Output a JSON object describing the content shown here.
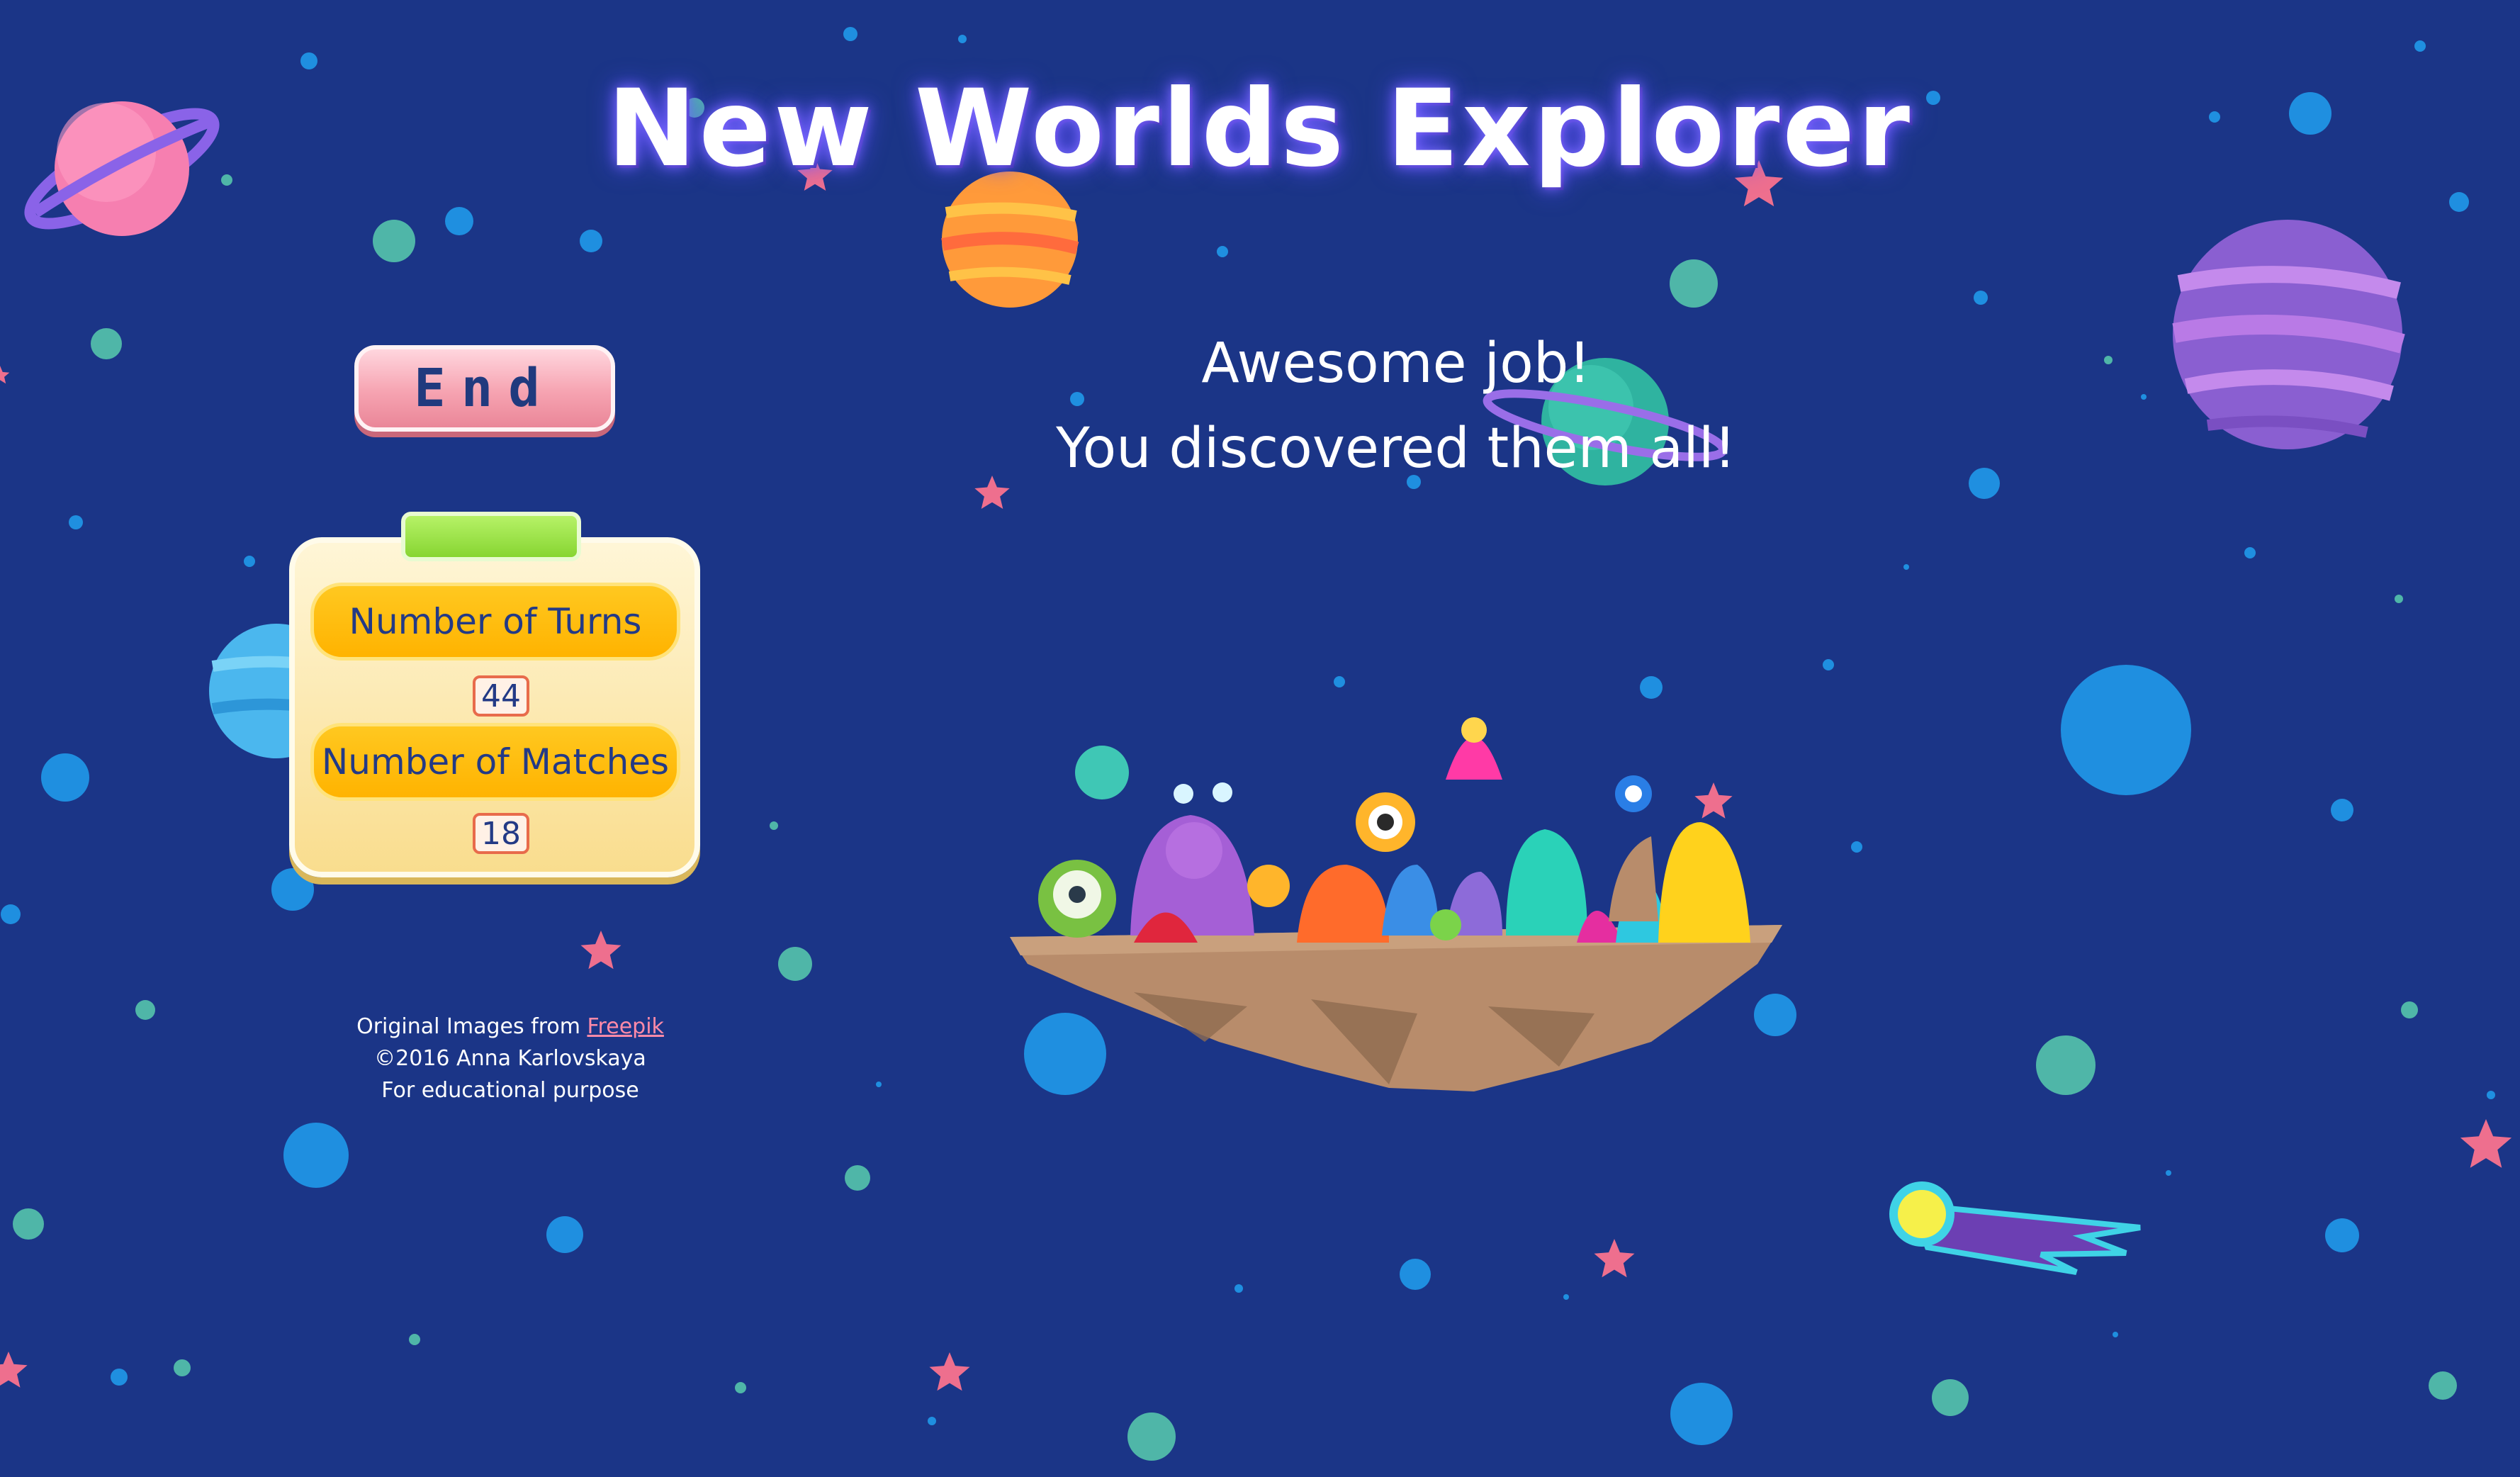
{
  "game": {
    "title": "New Worlds Explorer",
    "end_button_label": "End"
  },
  "scoreboard": {
    "turns_label": "Number of Turns",
    "turns_value": "44",
    "matches_label": "Number of Matches",
    "matches_value": "18"
  },
  "result": {
    "line1": "Awesome job!",
    "line2": "You discovered them all!"
  },
  "credits": {
    "images_prefix": "Original Images from ",
    "images_link": "Freepik",
    "copyright": "©2016 Anna Karlovskaya",
    "purpose": "For educational purpose"
  },
  "colors": {
    "background": "#1b3587",
    "title_glow": "#7d6bff",
    "end_button": "#f6a3b1",
    "score_label": "#ffb300",
    "link": "#ff8aa8"
  },
  "icons": {
    "planets": [
      "pink-ringed-planet-icon",
      "orange-striped-planet-icon",
      "teal-ringed-planet-icon",
      "purple-striped-planet-icon",
      "blue-planet-icon"
    ],
    "comet": "comet-icon",
    "island": "floating-island-icon",
    "monsters": "monster-group-icon",
    "stars": "star-icon"
  }
}
